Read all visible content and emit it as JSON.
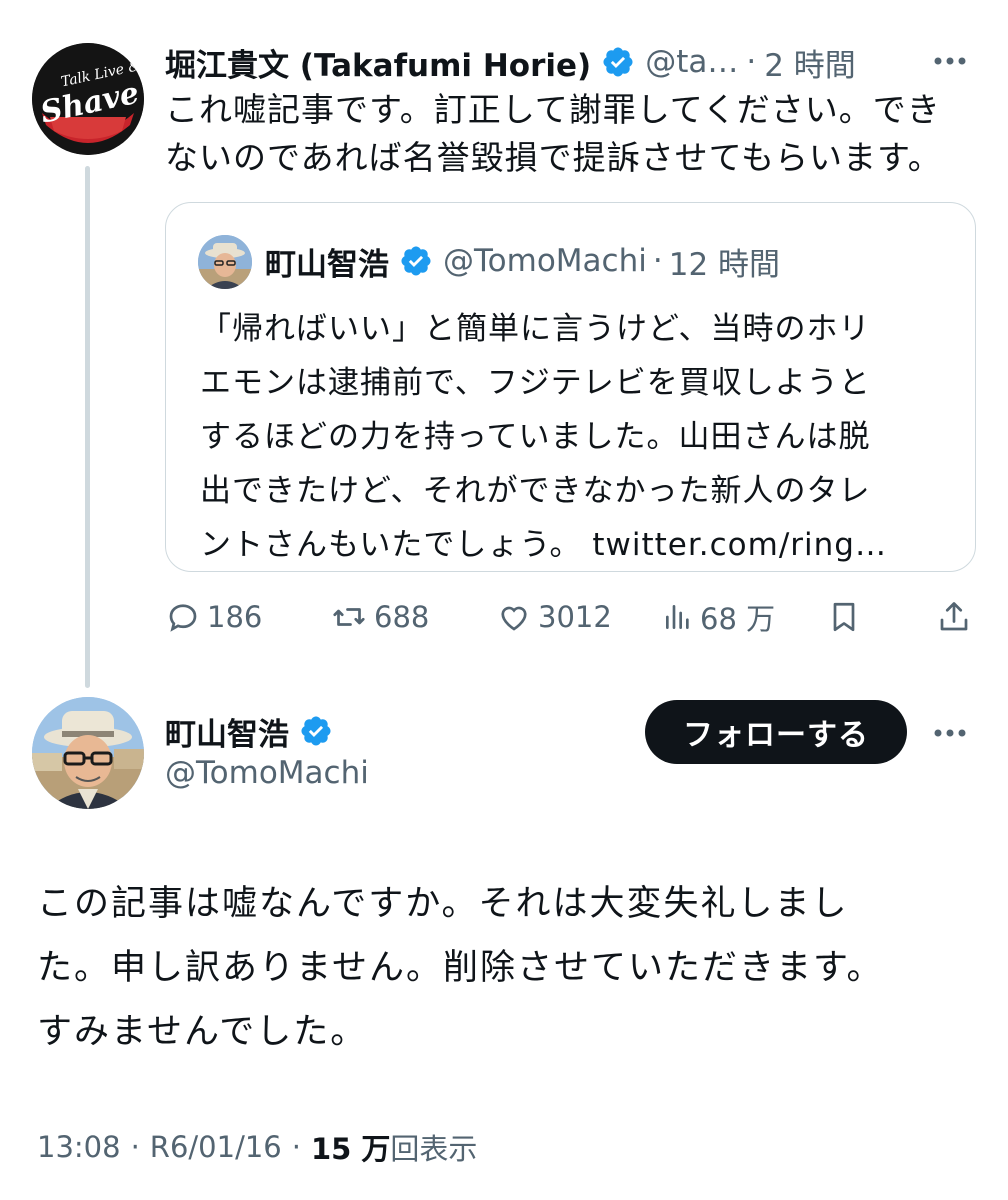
{
  "tweet1": {
    "author_name": "堀江貴文 (Takafumi Horie)",
    "author_handle": "@ta…",
    "separator": "·",
    "time": "2 時間",
    "text_lines": [
      "これ嘘記事です。訂正して謝罪してください。でき",
      "ないのであれば名誉毀損で提訴させてもらいます。"
    ],
    "avatar_logo_line1": "Talk Live & R",
    "avatar_logo_line2": "Shave"
  },
  "quote": {
    "author_name": "町山智浩",
    "author_handle": "@TomoMachi",
    "separator": "·",
    "time": "12 時間",
    "text_lines": [
      "「帰ればいい」と簡単に言うけど、当時のホリ",
      "エモンは逮捕前で、フジテレビを買収しようと",
      "するほどの力を持っていました。山田さんは脱",
      "出できたけど、それができなかった新人のタレ",
      "ントさんもいたでしょう。 twitter.com/ring…"
    ]
  },
  "actions": {
    "replies": "186",
    "retweets": "688",
    "likes": "3012",
    "views": "68 万"
  },
  "tweet2": {
    "author_name": "町山智浩",
    "author_handle": "@TomoMachi",
    "follow_label": "フォローする",
    "text_lines": [
      "この記事は嘘なんですか。それは大変失礼しまし",
      "た。申し訳ありません。削除させていただきます。",
      "すみませんでした。"
    ],
    "time": "13:08",
    "date": "R6/01/16",
    "sep": "·",
    "view_count": "15 万",
    "view_label": "回表示"
  },
  "colors": {
    "verified": "#1d9bf0",
    "text": "#0f1419",
    "secondary": "#536471",
    "border": "#cfd9de"
  },
  "icons": [
    "verified-badge-icon",
    "more-icon",
    "reply-icon",
    "retweet-icon",
    "like-icon",
    "views-icon",
    "bookmark-icon",
    "share-icon"
  ]
}
